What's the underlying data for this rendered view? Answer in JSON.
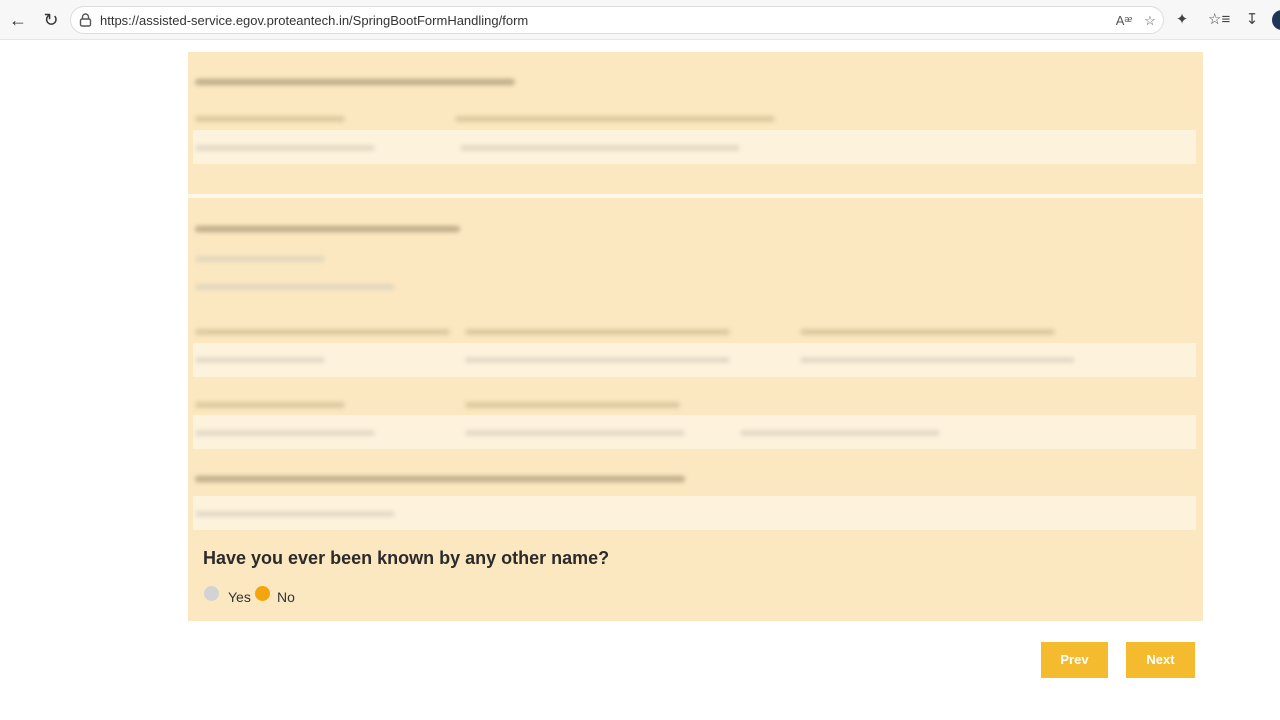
{
  "browser": {
    "url": "https://assisted-service.egov.proteantech.in/SpringBootFormHandling/form",
    "icons": [
      "back-arrow-icon",
      "reload-icon",
      "lock-icon",
      "read-aloud-icon",
      "favorite-star-icon",
      "extensions-icon",
      "favorites-list-icon",
      "download-icon",
      "profile-avatar"
    ]
  },
  "form": {
    "question": "Have you ever been known by any other name?",
    "options": [
      {
        "label": "Yes",
        "selected": false
      },
      {
        "label": "No",
        "selected": true
      }
    ],
    "prev_label": "Prev",
    "next_label": "Next"
  },
  "colors": {
    "panel": "#fbe8c0",
    "accent": "#f5bb2f",
    "radio_selected": "#f2a50c",
    "radio_unselected": "#d3d3d3"
  }
}
